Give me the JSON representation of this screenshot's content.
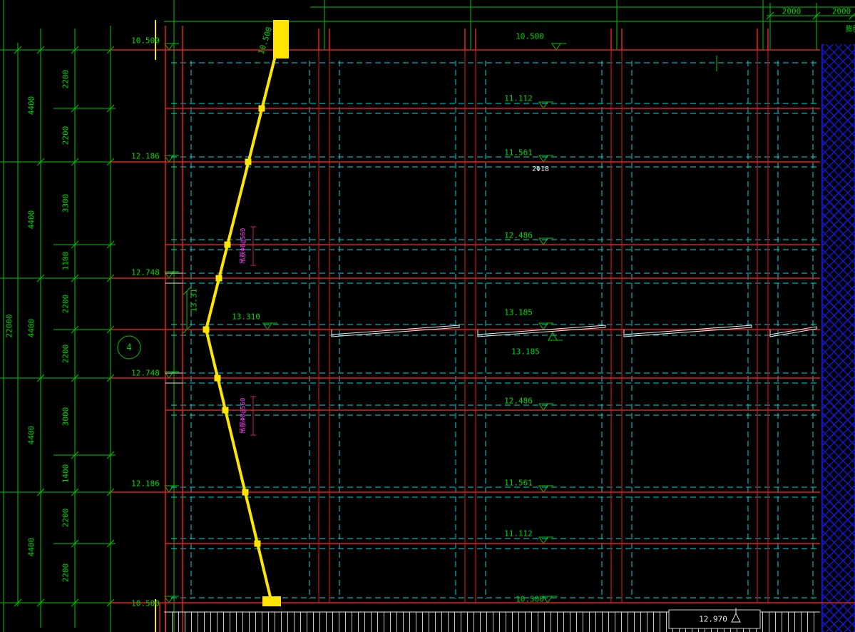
{
  "colors": {
    "background": "#000000",
    "grid": "#00c800",
    "beam": "#e02020",
    "column": "#9b1414",
    "hidden": "#00dcdc",
    "outline": "#ffe600",
    "hatch": "#1616d2",
    "note": "#ff3cff",
    "detail": "#e6e6e6"
  },
  "dimensions": {
    "overall_left": "22000",
    "outer_left": [
      "4400",
      "4400",
      "4400",
      "4400",
      "4400"
    ],
    "inner_left": [
      "2200",
      "2200",
      "3300",
      "1100",
      "2200",
      "2200",
      "3000",
      "1400",
      "2200",
      "2200"
    ],
    "top_right": [
      "2000",
      "2000"
    ]
  },
  "elevations": {
    "top_left": "10.500",
    "yellow_top": "10.500",
    "top_mid": "10.500",
    "row1": "11.112",
    "row2": "11.561",
    "row3": "12.486",
    "ridge_upper": "13.185",
    "ridge_lower": "13.185",
    "row5": "12.486",
    "row6": "11.561",
    "row7": "11.112",
    "bottom_mid": "10.500",
    "bottom_left": "10.500",
    "wall_upper_a": "12.186",
    "wall_upper_b": "12.748",
    "ridge_wall": "13.310",
    "ridge_wall_rot": "13.31",
    "wall_lower_b": "12.748",
    "wall_lower_a": "12.186",
    "deck_box": "12.970"
  },
  "annotations": {
    "rebar": "2Φ18",
    "purlin_note_upper": "吊筋Φ8@560",
    "purlin_note_lower": "吊筋Φ8@560",
    "axis_bubble": "4",
    "right_edge_label": "膨胀"
  }
}
